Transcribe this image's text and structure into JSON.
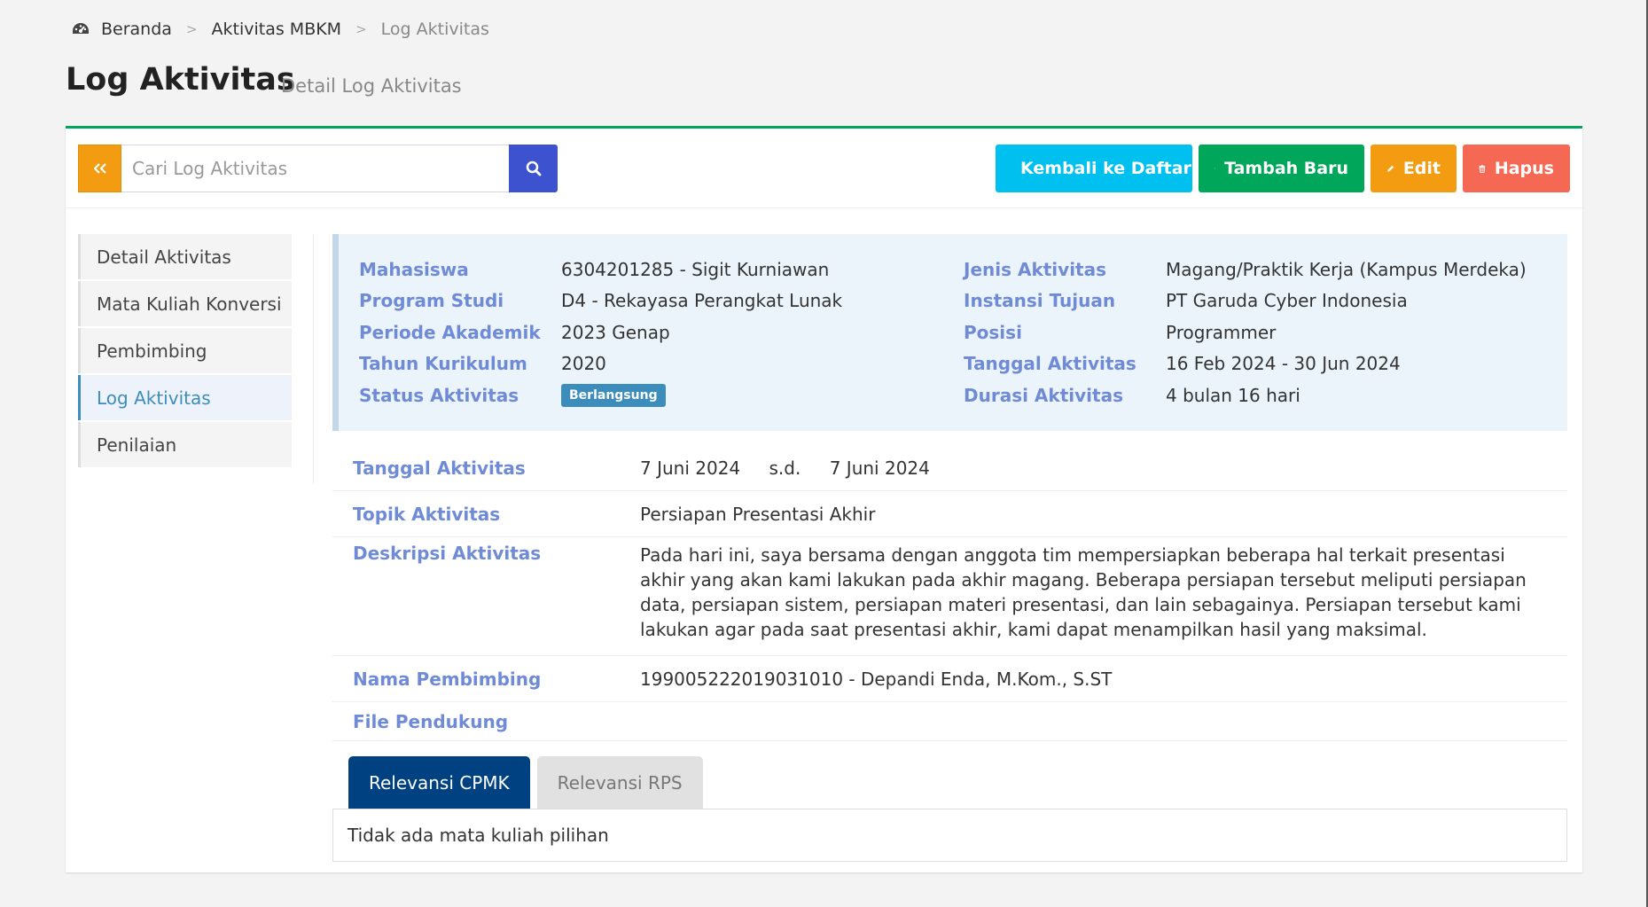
{
  "breadcrumb": {
    "home": "Beranda",
    "level1": "Aktivitas MBKM",
    "current": "Log Aktivitas"
  },
  "header": {
    "title": "Log Aktivitas",
    "subtitle": "Detail Log Aktivitas"
  },
  "search": {
    "placeholder": "Cari Log Aktivitas"
  },
  "actions": {
    "back": "Kembali ke Daftar",
    "add": "Tambah Baru",
    "edit": "Edit",
    "delete": "Hapus"
  },
  "sidenav": {
    "items": [
      "Detail Aktivitas",
      "Mata Kuliah Konversi",
      "Pembimbing",
      "Log Aktivitas",
      "Penilaian"
    ],
    "active_index": 3
  },
  "info": {
    "left": [
      {
        "label": "Mahasiswa",
        "value": "6304201285 - Sigit Kurniawan"
      },
      {
        "label": "Program Studi",
        "value": "D4 - Rekayasa Perangkat Lunak"
      },
      {
        "label": "Periode Akademik",
        "value": "2023 Genap"
      },
      {
        "label": "Tahun Kurikulum",
        "value": "2020"
      },
      {
        "label": "Status Aktivitas",
        "badge": "Berlangsung"
      }
    ],
    "right": [
      {
        "label": "Jenis Aktivitas",
        "value": "Magang/Praktik Kerja (Kampus Merdeka)"
      },
      {
        "label": "Instansi Tujuan",
        "value": "PT Garuda Cyber Indonesia"
      },
      {
        "label": "Posisi",
        "value": "Programmer"
      },
      {
        "label": "Tanggal Aktivitas",
        "value": "16 Feb 2024 - 30 Jun 2024"
      },
      {
        "label": "Durasi Aktivitas",
        "value": "4 bulan 16 hari"
      }
    ]
  },
  "detail": {
    "tanggal": {
      "label": "Tanggal Aktivitas",
      "start": "7 Juni 2024",
      "sep": "s.d.",
      "end": "7 Juni 2024"
    },
    "topik": {
      "label": "Topik Aktivitas",
      "value": "Persiapan Presentasi Akhir"
    },
    "deskripsi": {
      "label": "Deskripsi Aktivitas",
      "value": "Pada hari ini, saya bersama dengan anggota tim mempersiapkan beberapa hal terkait presentasi akhir yang akan kami lakukan pada akhir magang. Beberapa persiapan tersebut meliputi persiapan data, persiapan sistem, persiapan materi presentasi, dan lain sebagainya. Persiapan tersebut kami lakukan agar pada saat presentasi akhir, kami dapat menampilkan hasil yang maksimal."
    },
    "pembimbing": {
      "label": "Nama Pembimbing",
      "value": "199005222019031010 - Depandi Enda, M.Kom., S.ST"
    },
    "file": {
      "label": "File Pendukung",
      "value": ""
    }
  },
  "tabs": {
    "cpmk": "Relevansi CPMK",
    "rps": "Relevansi RPS",
    "empty_message": "Tidak ada mata kuliah pilihan"
  },
  "colors": {
    "accent_green": "#00a65a",
    "label_blue": "#6f8bd6",
    "active_tab": "#004182"
  }
}
